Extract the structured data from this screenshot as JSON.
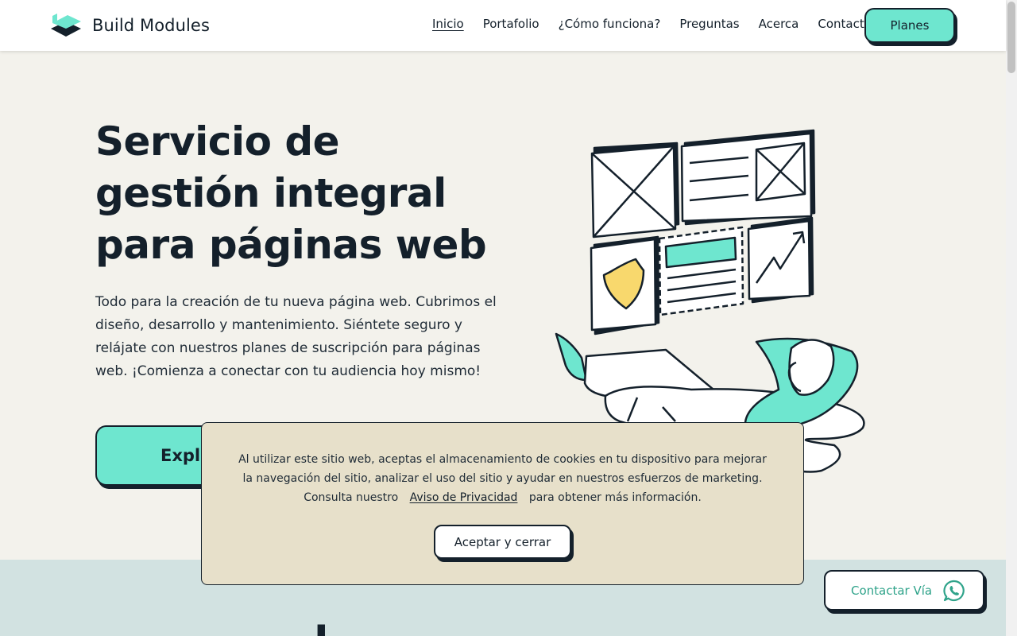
{
  "header": {
    "brand": "Build Modules",
    "nav": [
      "Inicio",
      "Portafolio",
      "¿Cómo funciona?",
      "Preguntas",
      "Acerca",
      "Contacto"
    ],
    "active_nav": "Inicio",
    "cta_label": "Planes"
  },
  "hero": {
    "title": "Servicio de gestión integral para páginas web",
    "description": "Todo para la creación de tu nueva página web. Cubrimos el diseño, desarrollo y mantenimiento. Siéntete seguro y relájate con nuestros planes de suscripción para páginas web. ¡Comienza a conectar con tu audiencia hoy mismo!",
    "cta_label": "Explo"
  },
  "lower_section": {
    "heading_fragment": "L"
  },
  "cookie_banner": {
    "text_before": "Al utilizar este sitio web, aceptas el almacenamiento de cookies en tu dispositivo para mejorar la navegación del sitio, analizar el uso del sitio y ayudar en nuestros esfuerzos de marketing. Consulta nuestro",
    "privacy_link": "Aviso de Privacidad",
    "text_after": "para obtener más información.",
    "accept_label": "Aceptar y cerrar"
  },
  "whatsapp": {
    "label": "Contactar Vía",
    "icon": "whatsapp-icon"
  },
  "colors": {
    "accent": "#6ee6cf",
    "dark": "#14202b",
    "hero_bg": "#f3f2ec",
    "cookie_bg": "#e7e0ca",
    "lower_bg": "#d2e2e1",
    "whatsapp_text": "#2fa38a"
  }
}
